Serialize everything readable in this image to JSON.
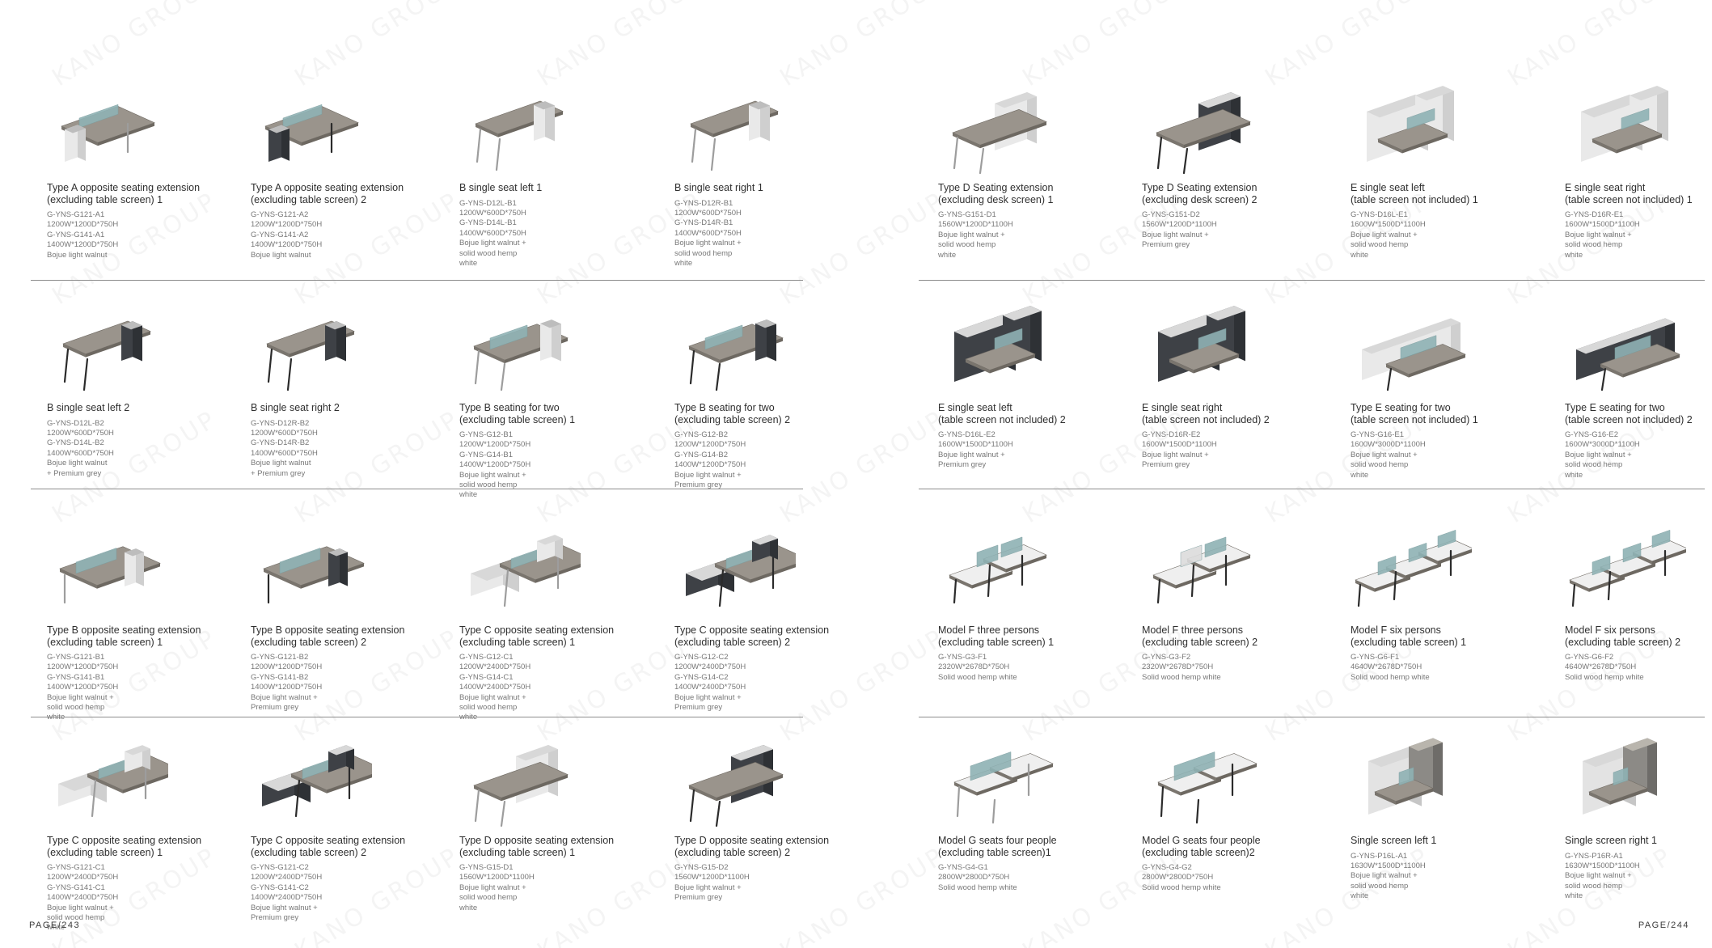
{
  "watermark": "KANO GROUP",
  "colors": {
    "walnut": "#8b857d",
    "walnut_top": "#9a948c",
    "grey": "#3e4146",
    "white": "#e9e9e9",
    "glass": "#8fb2b4",
    "leg": "#2b2b2b"
  },
  "left_page": {
    "page_number": "PAGE/243",
    "rows": [
      [
        {
          "name": "Type A opposite seating extension\n(excluding table screen) 1",
          "specs": "G-YNS-G121-A1\n1200W*1200D*750H\nG-YNS-G141-A1\n1400W*1200D*750H\nBojue light walnut",
          "icon": "desk-a-opposite-icon"
        },
        {
          "name": "Type A opposite seating extension\n(excluding table screen) 2",
          "specs": "G-YNS-G121-A2\n1200W*1200D*750H\nG-YNS-G141-A2\n1400W*1200D*750H\nBojue light walnut",
          "icon": "desk-a-opposite-icon"
        },
        {
          "name": "B single seat left 1",
          "specs": "G-YNS-D12L-B1\n1200W*600D*750H\nG-YNS-D14L-B1\n1400W*600D*750H\nBojue light walnut +\nsolid wood hemp\nwhite",
          "icon": "single-desk-icon"
        },
        {
          "name": "B single seat right 1",
          "specs": "G-YNS-D12R-B1\n1200W*600D*750H\nG-YNS-D14R-B1\n1400W*600D*750H\nBojue light walnut +\nsolid wood hemp\nwhite",
          "icon": "single-desk-icon"
        }
      ],
      [
        {
          "name": "B single seat left 2",
          "specs": "G-YNS-D12L-B2\n1200W*600D*750H\nG-YNS-D14L-B2\n1400W*600D*750H\nBojue light walnut\n+ Premium grey",
          "icon": "single-desk-icon"
        },
        {
          "name": "B single seat right 2",
          "specs": "G-YNS-D12R-B2\n1200W*600D*750H\nG-YNS-D14R-B2\n1400W*600D*750H\nBojue light walnut\n+ Premium grey",
          "icon": "single-desk-icon"
        },
        {
          "name": "Type B seating for two\n(excluding table screen) 1",
          "specs": "G-YNS-G12-B1\n1200W*1200D*750H\nG-YNS-G14-B1\n1400W*1200D*750H\nBojue light walnut +\nsolid wood hemp\nwhite",
          "icon": "two-seat-desk-icon"
        },
        {
          "name": "Type B seating for two\n(excluding table screen) 2",
          "specs": "G-YNS-G12-B2\n1200W*1200D*750H\nG-YNS-G14-B2\n1400W*1200D*750H\nBojue light walnut +\nPremium grey",
          "icon": "two-seat-desk-icon"
        }
      ],
      [
        {
          "name": "Type B opposite seating extension\n(excluding table screen) 1",
          "specs": "G-YNS-G121-B1\n1200W*1200D*750H\nG-YNS-G141-B1\n1400W*1200D*750H\nBojue light walnut +\nsolid wood hemp\nwhite",
          "icon": "opposite-desk-icon"
        },
        {
          "name": "Type B opposite seating extension\n(excluding table screen) 2",
          "specs": "G-YNS-G121-B2\n1200W*1200D*750H\nG-YNS-G141-B2\n1400W*1200D*750H\nBojue light walnut +\nPremium grey",
          "icon": "opposite-desk-icon"
        },
        {
          "name": "Type C opposite seating extension\n(excluding table screen) 1",
          "specs": "G-YNS-G12-C1\n1200W*2400D*750H\nG-YNS-G14-C1\n1400W*2400D*750H\nBojue light walnut +\nsolid wood hemp\nwhite",
          "icon": "opposite-desk-cabinet-icon"
        },
        {
          "name": "Type C opposite seating extension\n(excluding table screen) 2",
          "specs": "G-YNS-G12-C2\n1200W*2400D*750H\nG-YNS-G14-C2\n1400W*2400D*750H\nBojue light walnut +\nPremium grey",
          "icon": "opposite-desk-cabinet-icon"
        }
      ],
      [
        {
          "name": "Type C opposite seating extension\n(excluding table screen) 1",
          "specs": "G-YNS-G121-C1\n1200W*2400D*750H\nG-YNS-G141-C1\n1400W*2400D*750H\nBojue light walnut +\nsolid wood hemp\nwhite",
          "icon": "opposite-desk-cabinet-icon"
        },
        {
          "name": "Type C opposite seating extension\n(excluding table screen) 2",
          "specs": "G-YNS-G121-C2\n1200W*2400D*750H\nG-YNS-G141-C2\n1400W*2400D*750H\nBojue light walnut +\nPremium grey",
          "icon": "opposite-desk-cabinet-icon"
        },
        {
          "name": "Type D opposite seating extension\n(excluding table screen) 1",
          "specs": "G-YNS-G15-D1\n1560W*1200D*1100H\nBojue light walnut +\nsolid wood hemp\nwhite",
          "icon": "desk-tall-cabinet-icon"
        },
        {
          "name": "Type D opposite seating extension\n(excluding table screen) 2",
          "specs": "G-YNS-G15-D2\n1560W*1200D*1100H\nBojue light walnut +\nPremium grey",
          "icon": "desk-tall-cabinet-icon"
        }
      ]
    ]
  },
  "right_page": {
    "page_number": "PAGE/244",
    "rows": [
      [
        {
          "name": "Type D Seating extension\n(excluding desk screen) 1",
          "specs": "G-YNS-G151-D1\n1560W*1200D*1100H\nBojue light walnut +\nsolid wood hemp\nwhite",
          "icon": "desk-tall-cabinet-icon"
        },
        {
          "name": "Type D Seating extension\n(excluding desk screen) 2",
          "specs": "G-YNS-G151-D2\n1560W*1200D*1100H\nBojue light walnut +\nPremium grey",
          "icon": "desk-tall-cabinet-icon"
        },
        {
          "name": "E single seat left\n(table screen not included) 1",
          "specs": "G-YNS-D16L-E1\n1600W*1500D*1100H\nBojue light walnut +\nsolid wood hemp\nwhite",
          "icon": "l-desk-cabinet-icon"
        },
        {
          "name": "E single seat right\n (table screen not included) 1",
          "specs": "G-YNS-D16R-E1\n1600W*1500D*1100H\nBojue light walnut +\nsolid wood hemp\nwhite",
          "icon": "l-desk-cabinet-icon"
        }
      ],
      [
        {
          "name": "E single seat left\n (table screen not included) 2",
          "specs": "G-YNS-D16L-E2\n1600W*1500D*1100H\nBojue light walnut +\nPremium grey",
          "icon": "l-desk-cabinet-icon"
        },
        {
          "name": "E single seat right\n (table screen not included) 2",
          "specs": "G-YNS-D16R-E2\n1600W*1500D*1100H\nBojue light walnut +\nPremium grey",
          "icon": "l-desk-cabinet-icon"
        },
        {
          "name": "Type E seating for two\n (table screen not included) 1",
          "specs": "G-YNS-G16-E1\n1600W*3000D*1100H\nBojue light walnut +\nsolid wood hemp\nwhite",
          "icon": "long-cabinet-desk-icon"
        },
        {
          "name": "Type E seating for two\n (table screen not included) 2",
          "specs": "G-YNS-G16-E2\n1600W*3000D*1100H\nBojue light walnut +\nsolid wood hemp\nwhite",
          "icon": "long-cabinet-desk-icon"
        }
      ],
      [
        {
          "name": "Model F three persons\n(excluding table screen) 1",
          "specs": "G-YNS-G3-F1\n2320W*2678D*750H\nSolid wood hemp white",
          "icon": "three-person-workstation-icon"
        },
        {
          "name": "Model F three persons\n(excluding table screen) 2",
          "specs": "G-YNS-G3-F2\n2320W*2678D*750H\nSolid wood hemp white",
          "icon": "three-person-workstation-icon"
        },
        {
          "name": "Model F six persons\n(excluding table screen) 1",
          "specs": "G-YNS-G6-F1\n4640W*2678D*750H\nSolid wood hemp white",
          "icon": "six-person-workstation-icon"
        },
        {
          "name": "Model F six persons\n(excluding table screen) 2",
          "specs": "G-YNS-G6-F2\n4640W*2678D*750H\nSolid wood hemp white",
          "icon": "six-person-workstation-icon"
        }
      ],
      [
        {
          "name": "Model G seats four people\n(excluding table screen)1",
          "specs": "G-YNS-G4-G1\n2800W*2800D*750H\nSolid wood hemp white",
          "icon": "four-person-workstation-icon"
        },
        {
          "name": "Model G seats four people\n(excluding table screen)2",
          "specs": "G-YNS-G4-G2\n2800W*2800D*750H\nSolid wood hemp white",
          "icon": "four-person-workstation-icon"
        },
        {
          "name": "Single screen left 1",
          "specs": "G-YNS-P16L-A1\n1630W*1500D*1100H\nBojue light walnut +\nsolid wood hemp\nwhite",
          "icon": "single-screen-station-icon"
        },
        {
          "name": "Single screen right 1",
          "specs": "G-YNS-P16R-A1\n1630W*1500D*1100H\nBojue light walnut +\nsolid wood hemp\nwhite",
          "icon": "single-screen-station-icon"
        }
      ]
    ]
  }
}
